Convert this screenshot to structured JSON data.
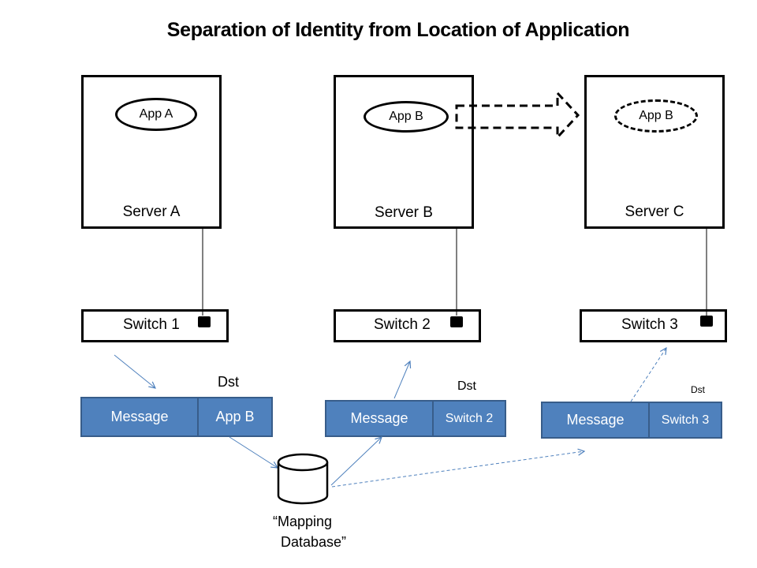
{
  "title": "Separation of Identity from Location of Application",
  "servers": [
    {
      "label": "Server A",
      "app": "App A",
      "app_style": "solid"
    },
    {
      "label": "Server B",
      "app": "App B",
      "app_style": "solid"
    },
    {
      "label": "Server C",
      "app": "App B",
      "app_style": "dashed"
    }
  ],
  "switches": [
    {
      "label": "Switch 1"
    },
    {
      "label": "Switch 2"
    },
    {
      "label": "Switch 3"
    }
  ],
  "messages": [
    {
      "payload": "Message",
      "dst_value": "App B",
      "dst_label": "Dst"
    },
    {
      "payload": "Message",
      "dst_value": "Switch 2",
      "dst_label": "Dst"
    },
    {
      "payload": "Message",
      "dst_value": "Switch 3",
      "dst_label": "Dst"
    }
  ],
  "database": {
    "line1": "“Mapping",
    "line2": "Database”"
  },
  "colors": {
    "message_fill": "#4f81bd",
    "message_border": "#385d8a",
    "arrow": "#4f81bd"
  }
}
